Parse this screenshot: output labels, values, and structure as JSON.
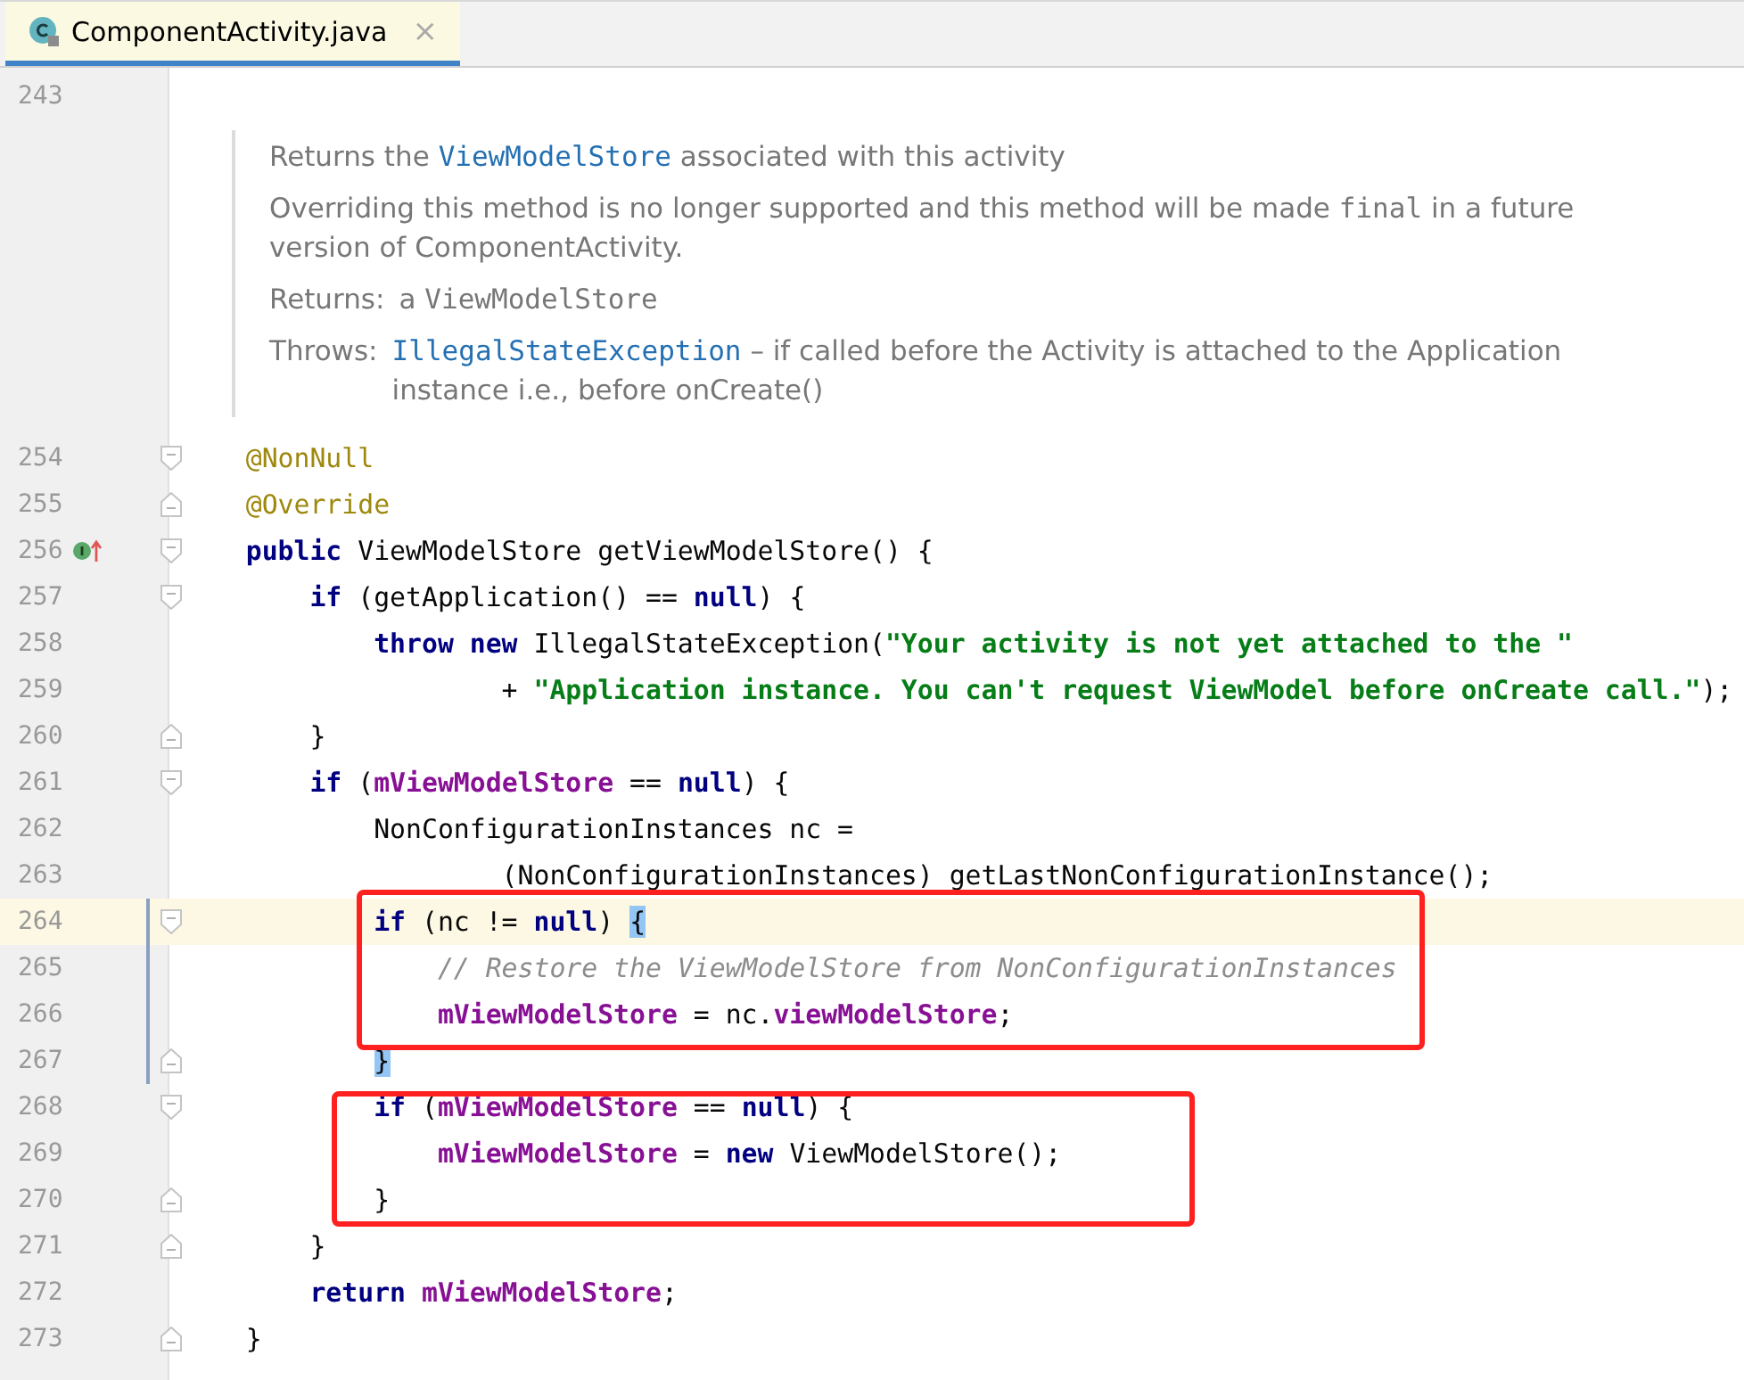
{
  "tab": {
    "title": "ComponentActivity.java",
    "close": "×",
    "selected": true
  },
  "rows": [
    {
      "kind": "code",
      "number": "243",
      "fold_start": false,
      "fold_end": false,
      "implemented": false,
      "current": false,
      "changed": false,
      "tokens": []
    },
    {
      "kind": "doc",
      "paragraphs": [
        {
          "kind": "text",
          "segments": [
            {
              "kind": "text",
              "text": "Returns the "
            },
            {
              "kind": "link",
              "text": "ViewModelStore"
            },
            {
              "kind": "text",
              "text": " associated with this activity"
            }
          ]
        },
        {
          "kind": "text",
          "segments": [
            {
              "kind": "text",
              "text": "Overriding this method is no longer supported and this method will be made "
            },
            {
              "kind": "code",
              "text": "final"
            },
            {
              "kind": "text",
              "text": " in a future version of ComponentActivity."
            }
          ]
        },
        {
          "kind": "field",
          "label": "Returns:",
          "segments": [
            {
              "kind": "text",
              "text": "a "
            },
            {
              "kind": "code",
              "text": "ViewModelStore"
            }
          ]
        },
        {
          "kind": "field",
          "label": "Throws:",
          "segments": [
            {
              "kind": "link",
              "text": "IllegalStateException"
            },
            {
              "kind": "text",
              "text": " – if called before the Activity is attached to the Application instance i.e., before onCreate()"
            }
          ]
        }
      ]
    },
    {
      "kind": "code",
      "number": "254",
      "fold_start": true,
      "fold_end": false,
      "implemented": false,
      "current": false,
      "changed": false,
      "tokens": [
        {
          "kind": "ann",
          "text": "    @NonNull"
        }
      ]
    },
    {
      "kind": "code",
      "number": "255",
      "fold_start": false,
      "fold_end": true,
      "implemented": false,
      "current": false,
      "changed": false,
      "tokens": [
        {
          "kind": "ann",
          "text": "    @Override"
        }
      ]
    },
    {
      "kind": "code",
      "number": "256",
      "fold_start": true,
      "fold_end": false,
      "implemented": true,
      "current": false,
      "changed": false,
      "tokens": [
        {
          "kind": "kw",
          "text": "    public "
        },
        {
          "kind": "plain",
          "text": "ViewModelStore getViewModelStore() {"
        }
      ]
    },
    {
      "kind": "code",
      "number": "257",
      "fold_start": true,
      "fold_end": false,
      "implemented": false,
      "current": false,
      "changed": false,
      "tokens": [
        {
          "kind": "kw",
          "text": "        if "
        },
        {
          "kind": "plain",
          "text": "(getApplication() == "
        },
        {
          "kind": "kw",
          "text": "null"
        },
        {
          "kind": "plain",
          "text": ") {"
        }
      ]
    },
    {
      "kind": "code",
      "number": "258",
      "fold_start": false,
      "fold_end": false,
      "implemented": false,
      "current": false,
      "changed": false,
      "tokens": [
        {
          "kind": "kw",
          "text": "            throw new "
        },
        {
          "kind": "plain",
          "text": "IllegalStateException("
        },
        {
          "kind": "str",
          "text": "\"Your activity is not yet attached to the \""
        }
      ]
    },
    {
      "kind": "code",
      "number": "259",
      "fold_start": false,
      "fold_end": false,
      "implemented": false,
      "current": false,
      "changed": false,
      "tokens": [
        {
          "kind": "plain",
          "text": "                    + "
        },
        {
          "kind": "str",
          "text": "\"Application instance. You can't request ViewModel before onCreate call.\""
        },
        {
          "kind": "plain",
          "text": ");"
        }
      ]
    },
    {
      "kind": "code",
      "number": "260",
      "fold_start": false,
      "fold_end": true,
      "implemented": false,
      "current": false,
      "changed": false,
      "tokens": [
        {
          "kind": "plain",
          "text": "        }"
        }
      ]
    },
    {
      "kind": "code",
      "number": "261",
      "fold_start": true,
      "fold_end": false,
      "implemented": false,
      "current": false,
      "changed": false,
      "tokens": [
        {
          "kind": "kw",
          "text": "        if "
        },
        {
          "kind": "plain",
          "text": "("
        },
        {
          "kind": "field",
          "text": "mViewModelStore"
        },
        {
          "kind": "plain",
          "text": " == "
        },
        {
          "kind": "kw",
          "text": "null"
        },
        {
          "kind": "plain",
          "text": ") {"
        }
      ]
    },
    {
      "kind": "code",
      "number": "262",
      "fold_start": false,
      "fold_end": false,
      "implemented": false,
      "current": false,
      "changed": false,
      "tokens": [
        {
          "kind": "plain",
          "text": "            NonConfigurationInstances nc ="
        }
      ]
    },
    {
      "kind": "code",
      "number": "263",
      "fold_start": false,
      "fold_end": false,
      "implemented": false,
      "current": false,
      "changed": false,
      "tokens": [
        {
          "kind": "plain",
          "text": "                    (NonConfigurationInstances) getLastNonConfigurationInstance();"
        }
      ]
    },
    {
      "kind": "code",
      "number": "264",
      "fold_start": true,
      "fold_end": false,
      "implemented": false,
      "current": true,
      "changed": true,
      "tokens": [
        {
          "kind": "kw",
          "text": "            if "
        },
        {
          "kind": "plain",
          "text": "(nc != "
        },
        {
          "kind": "kw",
          "text": "null"
        },
        {
          "kind": "plain",
          "text": ") "
        },
        {
          "kind": "match",
          "text": "{"
        }
      ]
    },
    {
      "kind": "code",
      "number": "265",
      "fold_start": false,
      "fold_end": false,
      "implemented": false,
      "current": false,
      "changed": true,
      "tokens": [
        {
          "kind": "com",
          "text": "                // Restore the ViewModelStore from NonConfigurationInstances"
        }
      ]
    },
    {
      "kind": "code",
      "number": "266",
      "fold_start": false,
      "fold_end": false,
      "implemented": false,
      "current": false,
      "changed": true,
      "tokens": [
        {
          "kind": "field",
          "text": "                mViewModelStore"
        },
        {
          "kind": "plain",
          "text": " = nc."
        },
        {
          "kind": "field",
          "text": "viewModelStore"
        },
        {
          "kind": "plain",
          "text": ";"
        }
      ]
    },
    {
      "kind": "code",
      "number": "267",
      "fold_start": false,
      "fold_end": true,
      "implemented": false,
      "current": false,
      "changed": true,
      "tokens": [
        {
          "kind": "match",
          "text": "            }"
        }
      ]
    },
    {
      "kind": "code",
      "number": "268",
      "fold_start": true,
      "fold_end": false,
      "implemented": false,
      "current": false,
      "changed": false,
      "tokens": [
        {
          "kind": "kw",
          "text": "            if "
        },
        {
          "kind": "plain",
          "text": "("
        },
        {
          "kind": "field",
          "text": "mViewModelStore"
        },
        {
          "kind": "plain",
          "text": " == "
        },
        {
          "kind": "kw",
          "text": "null"
        },
        {
          "kind": "plain",
          "text": ") {"
        }
      ]
    },
    {
      "kind": "code",
      "number": "269",
      "fold_start": false,
      "fold_end": false,
      "implemented": false,
      "current": false,
      "changed": false,
      "tokens": [
        {
          "kind": "field",
          "text": "                mViewModelStore"
        },
        {
          "kind": "plain",
          "text": " = "
        },
        {
          "kind": "kw",
          "text": "new "
        },
        {
          "kind": "plain",
          "text": "ViewModelStore();"
        }
      ]
    },
    {
      "kind": "code",
      "number": "270",
      "fold_start": false,
      "fold_end": true,
      "implemented": false,
      "current": false,
      "changed": false,
      "tokens": [
        {
          "kind": "plain",
          "text": "            }"
        }
      ]
    },
    {
      "kind": "code",
      "number": "271",
      "fold_start": false,
      "fold_end": true,
      "implemented": false,
      "current": false,
      "changed": false,
      "tokens": [
        {
          "kind": "plain",
          "text": "        }"
        }
      ]
    },
    {
      "kind": "code",
      "number": "272",
      "fold_start": false,
      "fold_end": false,
      "implemented": false,
      "current": false,
      "changed": false,
      "tokens": [
        {
          "kind": "kw",
          "text": "        return "
        },
        {
          "kind": "field",
          "text": "mViewModelStore"
        },
        {
          "kind": "plain",
          "text": ";"
        }
      ]
    },
    {
      "kind": "code",
      "number": "273",
      "fold_start": false,
      "fold_end": true,
      "implemented": false,
      "current": false,
      "changed": false,
      "tokens": [
        {
          "kind": "plain",
          "text": "    }"
        }
      ]
    }
  ],
  "annotations": [
    {
      "kind": "box"
    },
    {
      "kind": "box"
    }
  ]
}
